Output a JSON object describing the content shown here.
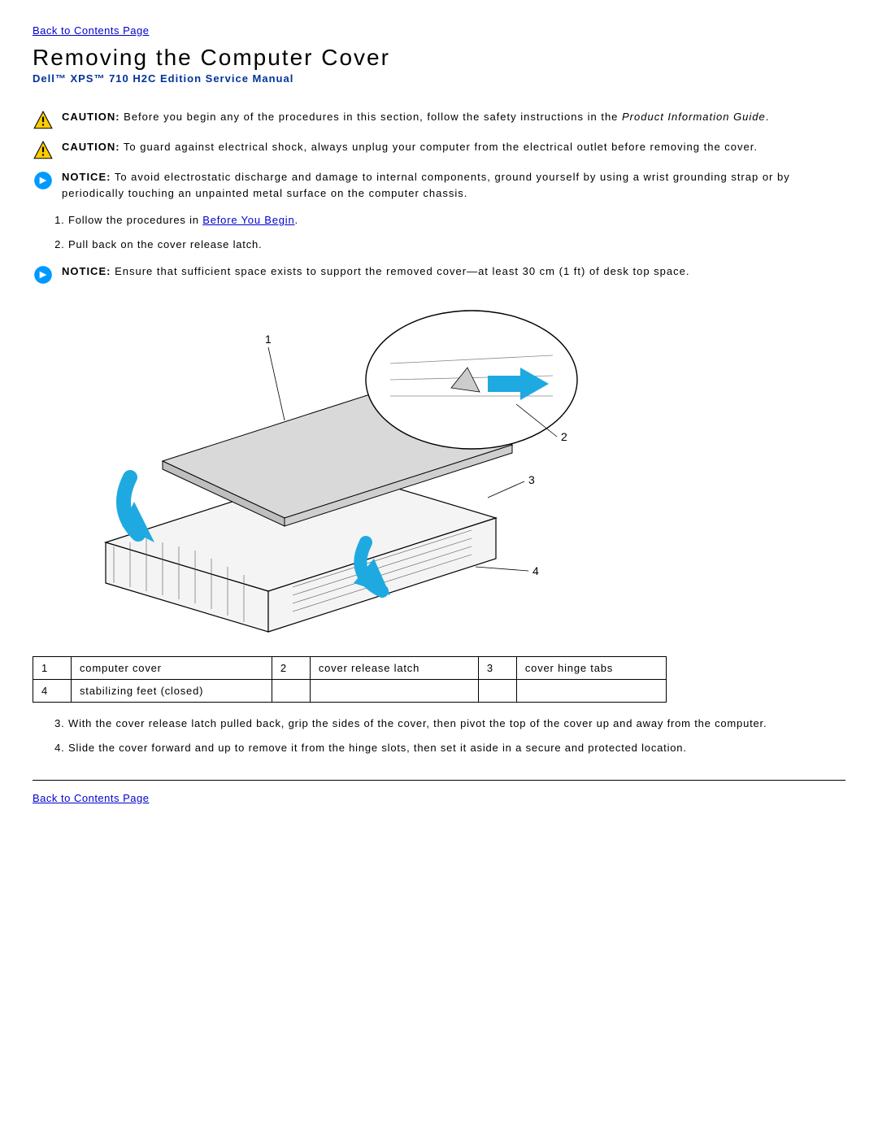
{
  "nav": {
    "back_top": "Back to Contents Page",
    "back_bottom": "Back to Contents Page"
  },
  "title": "Removing the Computer Cover",
  "subtitle": "Dell™ XPS™ 710 H2C Edition Service Manual",
  "alerts": {
    "caution1_label": "CAUTION:",
    "caution1_text_a": " Before you begin any of the procedures in this section, follow the safety instructions in the ",
    "caution1_text_b": "Product Information Guide",
    "caution1_text_c": ".",
    "caution2_label": "CAUTION:",
    "caution2_text": " To guard against electrical shock, always unplug your computer from the electrical outlet before removing the cover.",
    "notice1_label": "NOTICE:",
    "notice1_text": " To avoid electrostatic discharge and damage to internal components, ground yourself by using a wrist grounding strap or by periodically touching an unpainted metal surface on the computer chassis.",
    "notice2_label": "NOTICE:",
    "notice2_text": " Ensure that sufficient space exists to support the removed cover—at least 30 cm (1 ft) of desk top space."
  },
  "steps": {
    "s1_a": "Follow the procedures in ",
    "s1_link": "Before You Begin",
    "s1_b": ".",
    "s2": "Pull back on the cover release latch.",
    "s3": "With the cover release latch pulled back, grip the sides of the cover, then pivot the top of the cover up and away from the computer.",
    "s4": "Slide the cover forward and up to remove it from the hinge slots, then set it aside in a secure and protected location."
  },
  "callouts": {
    "n1": "1",
    "t1": "computer cover",
    "n2": "2",
    "t2": "cover release latch",
    "n3": "3",
    "t3": "cover hinge tabs",
    "n4": "4",
    "t4": "stabilizing feet (closed)"
  },
  "figure_labels": {
    "l1": "1",
    "l2": "2",
    "l3": "3",
    "l4": "4"
  }
}
